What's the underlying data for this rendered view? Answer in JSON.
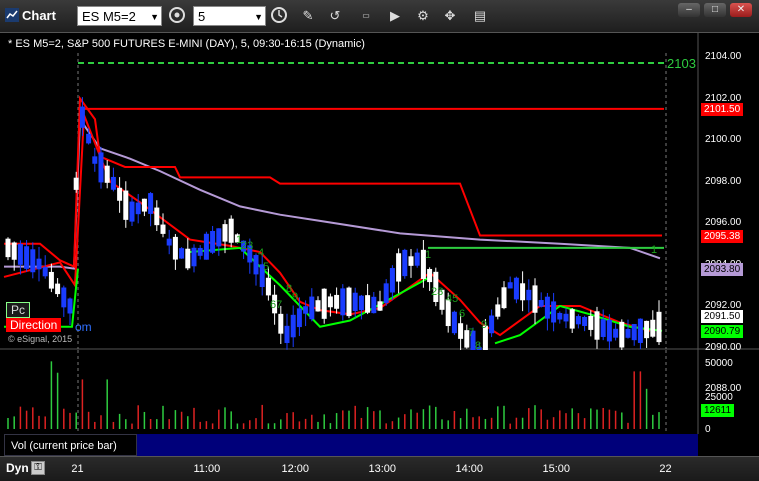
{
  "window": {
    "title": "Chart",
    "symbol_value": "ES M5=2",
    "interval_value": "5"
  },
  "chart": {
    "header": "* ES M5=2, S&P 500 FUTURES E-MINI (DAY), 5, 09:30-16:15 (Dynamic)",
    "line_label": "2103",
    "price_ticks": [
      "2104.00",
      "2102.00",
      "2100.00",
      "2098.00",
      "2096.00",
      "2094.00",
      "2092.00",
      "2090.00",
      "2088.00"
    ],
    "badges": [
      {
        "text": "2101.50",
        "bg": "#ff0000",
        "fg": "#ffffff"
      },
      {
        "text": "2095.38",
        "bg": "#ff0000",
        "fg": "#ffffff"
      },
      {
        "text": "2093.80",
        "bg": "#b59ad6",
        "fg": "#000000"
      },
      {
        "text": "2091.50",
        "bg": "#ffffff",
        "fg": "#000000"
      },
      {
        "text": "2090.79",
        "bg": "#00ff00",
        "fg": "#000000"
      }
    ],
    "tags": {
      "pc": "Pc",
      "direction": "Direction",
      "om": "om"
    },
    "copyright": "© eSignal, 2015",
    "count_labels": [
      {
        "text": "1"
      },
      {
        "text": "23"
      },
      {
        "text": "4"
      },
      {
        "text": "5"
      },
      {
        "text": "67"
      },
      {
        "text": "8"
      },
      {
        "text": "9"
      },
      {
        "text": "1"
      },
      {
        "text": "23"
      },
      {
        "text": "45"
      },
      {
        "text": "6"
      },
      {
        "text": "7"
      },
      {
        "text": "8"
      },
      {
        "text": "9"
      },
      {
        "text": "1"
      }
    ]
  },
  "volume": {
    "ticks": [
      "50000",
      "25000",
      "0"
    ],
    "badge": "12611",
    "label": "Vol (current price bar)"
  },
  "time_axis": {
    "label": "Dyn",
    "ticks": [
      "21",
      "11:00",
      "12:00",
      "13:00",
      "14:00",
      "15:00",
      "22"
    ]
  },
  "colors": {
    "up_candle": "#ffffff",
    "down_candle": "#1a3cff",
    "red_line": "#ff0000",
    "purple_line": "#b59ad6",
    "green_line": "#00ff00",
    "count": "#1a9e1a"
  }
}
